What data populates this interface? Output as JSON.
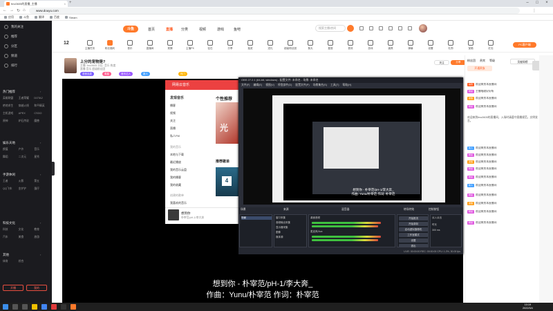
{
  "browser": {
    "tab_title": "fmc0605的直播_主播",
    "url": "www.douyu.com",
    "bookmarks": [
      "应用",
      "斗鱼",
      "翻译",
      "百度",
      "Steam"
    ]
  },
  "header": {
    "logo": "斗鱼",
    "nav": [
      "首页",
      "直播",
      "分类",
      "视频",
      "游戏",
      "鱼吧"
    ],
    "active_nav": "直播",
    "search_placeholder": "搜索主播/房间"
  },
  "catbar": {
    "rank": "12",
    "items": [
      "主播任务",
      "粉丝福利",
      "音乐",
      "直播间",
      "竞猜",
      "主播PK",
      "钻石",
      "分享",
      "抽奖",
      "送礼",
      "超级粉丝团",
      "鱼丸",
      "星座",
      "音效",
      "游戏",
      "道具",
      "弹幕",
      "设置",
      "礼物",
      "宝箱",
      "红包"
    ],
    "pc_button": "PC客户端"
  },
  "room": {
    "title": "上分的宠物是?",
    "meta1": "主播: fmc0605  分区: 音乐  热度",
    "meta2": "直播  音乐  超级粉丝团",
    "tags": [
      "语音连麦",
      "周星",
      "音乐达人",
      "新人",
      "热门"
    ],
    "actions": [
      "关注",
      "分享"
    ]
  },
  "netease": {
    "header": "网易云音乐",
    "nav": [
      "发现音乐",
      "播客",
      "视频",
      "关注",
      "直播",
      "私人FM",
      "我的音乐",
      "本地与下载",
      "最近播放",
      "我的音乐云盘",
      "我的播客",
      "我的收藏",
      "创建的歌单",
      "我喜欢的音乐"
    ],
    "rec_title": "个性推荐",
    "rec_img_text": "光",
    "list_title": "推荐歌单",
    "cal_num": "4",
    "player_song": "想到你",
    "player_artist": "朴宰范/pH-1/李大奔"
  },
  "obs": {
    "title": "OBS 27.2.1 (64-bit, windows) - 配置文件: 未命名 - 场景: 未命名",
    "menu": "文件(F) 编辑(E) 视图(V) 停靠部件(D) 配置文件(P) 场景集合(S) 工具(T) 帮助(H)",
    "preview_caption_1": "想到你 - 朴宰范/pH-1/李大奔_",
    "preview_caption_2": "作曲: Yunu/朴宰范 作词: 朴宰范",
    "docks": [
      "场景",
      "来源",
      "混音器",
      "转场特效",
      "控制按钮"
    ],
    "scenes": [
      "场景"
    ],
    "sources": [
      "窗口采集",
      "音频输出采集",
      "显示器采集",
      "图像",
      "媒体源"
    ],
    "mixer": [
      "桌面音频",
      "麦克风/Aux"
    ],
    "transition": [
      "淡入淡出",
      "时长",
      "300 ms"
    ],
    "controls": [
      "开始推流",
      "开始录制",
      "启动虚拟摄像机",
      "工作室模式",
      "设置",
      "退出"
    ],
    "status": "LIVE: 00:00:00  REC: 00:00:00  CPU: 1.2%, 30.00 fps"
  },
  "lyrics": {
    "line1": "想到你 - 朴宰范/pH-1/李大奔_",
    "line2": "作曲：Yunu/朴宰范 作词：朴宰范"
  },
  "right_panel": {
    "tabs": [
      "粉丝团",
      "贵宾",
      "等级"
    ],
    "open_btn": "开通贵族",
    "rank_btn": "贡献周榜",
    "chat": [
      {
        "badge": "房管",
        "text": "欢迎来到本直播间"
      },
      {
        "badge": "粉丝",
        "text": "主播唱歌好好听"
      },
      {
        "badge": "贵族",
        "text": "欢迎来到本直播间"
      },
      {
        "badge": "粉丝",
        "text": "欢迎来到本直播间"
      },
      {
        "badge": "新人",
        "text": "欢迎来到本直播间"
      },
      {
        "badge": "粉丝",
        "text": "欢迎来到本直播间"
      },
      {
        "badge": "贵族",
        "text": "欢迎来到本直播间"
      },
      {
        "badge": "粉丝",
        "text": "欢迎来到本直播间"
      },
      {
        "badge": "粉丝",
        "text": "欢迎来到本直播间"
      },
      {
        "badge": "新人",
        "text": "欢迎来到本直播间"
      },
      {
        "badge": "粉丝",
        "text": "欢迎来到本直播间"
      },
      {
        "badge": "贵族",
        "text": "欢迎来到本直播间"
      },
      {
        "badge": "粉丝",
        "text": "欢迎来到本直播间"
      },
      {
        "badge": "粉丝",
        "text": "欢迎来到本直播间"
      }
    ],
    "notice": "欢迎来到fmc0605的直播间，入场时请遵守直播规范，文明发言。"
  },
  "sidebar": {
    "items": [
      "我的关注",
      "推荐",
      "分区",
      "频道",
      "排行"
    ],
    "sections": [
      {
        "title": "热门推荐",
        "items": [
          "英雄联盟",
          "王者荣耀",
          "DOTA2",
          "绝地求生",
          "穿越火线",
          "和平精英",
          "主机游戏",
          "APEX",
          "CSGO",
          "原神",
          "炉石传说",
          "魔兽"
        ]
      },
      {
        "title": "娱乐天地",
        "items": [
          "颜值",
          "户外",
          "音乐",
          "舞蹈",
          "二次元",
          "星秀"
        ]
      },
      {
        "title": "手游休闲",
        "items": [
          "王者",
          "火影",
          "第五",
          "QQ飞车",
          "金铲铲",
          "蛋仔"
        ]
      },
      {
        "title": "科技文化",
        "items": [
          "科技",
          "文化",
          "教育",
          "汽车",
          "美食",
          "旅游"
        ]
      },
      {
        "title": "其他",
        "items": [
          "体育",
          "综合"
        ]
      }
    ],
    "btn_left": "开播",
    "btn_right": "我的"
  },
  "taskbar": {
    "time": "10:19",
    "date": "2022/3/4"
  }
}
